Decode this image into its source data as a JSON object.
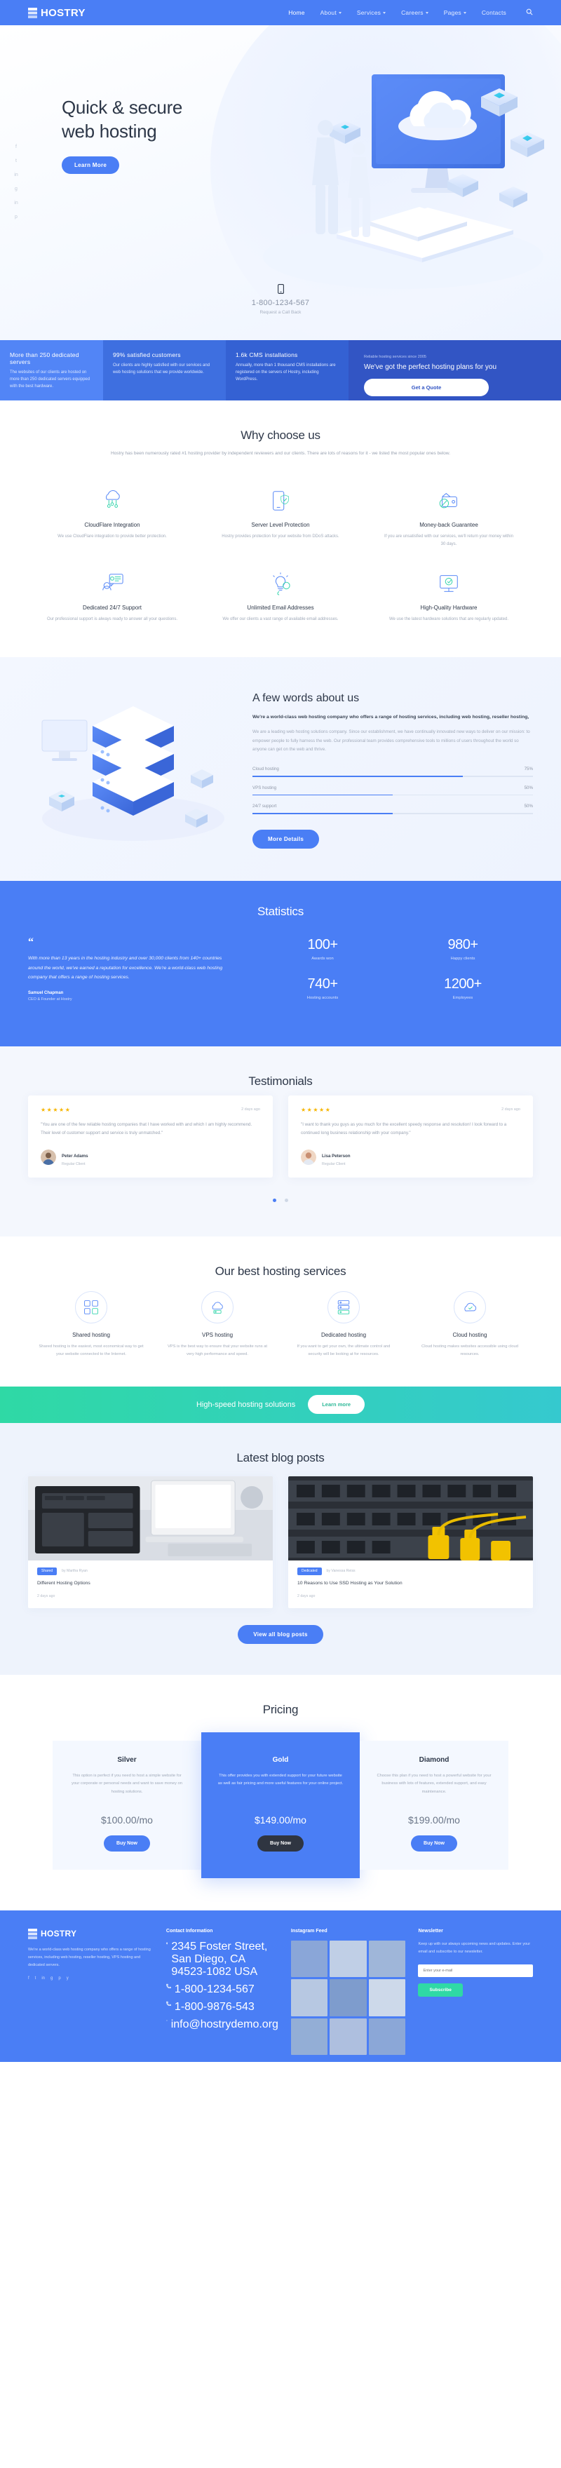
{
  "brand": {
    "name": "HOSTRY",
    "accent": "#4a7ef5",
    "teal": "#2fd9a5",
    "dark": "#2f3541"
  },
  "header": {
    "nav": [
      {
        "label": "Home",
        "caret": false,
        "active": true
      },
      {
        "label": "About",
        "caret": true,
        "active": false
      },
      {
        "label": "Services",
        "caret": true,
        "active": false
      },
      {
        "label": "Careers",
        "caret": true,
        "active": false
      },
      {
        "label": "Pages",
        "caret": true,
        "active": false
      },
      {
        "label": "Contacts",
        "caret": false,
        "active": false
      }
    ],
    "search_icon": "search-icon"
  },
  "hero": {
    "title_line1": "Quick & secure",
    "title_line2": "web hosting",
    "cta": "Learn More",
    "social": [
      "f",
      "t",
      "in",
      "g",
      "in",
      "p"
    ],
    "phone_icon": "mobile-phone-icon",
    "phone": "1-800-1234-567",
    "phone_sub": "Request a Call Back"
  },
  "featurebar": {
    "items": [
      {
        "title": "More than 250 dedicated servers",
        "text": "The websites of our clients are hosted on more than 250 dedicated servers equipped with the best hardware."
      },
      {
        "title": "99% satisfied customers",
        "text": "Our clients are highly satisfied with our services and web hosting solutions that we provide worldwide."
      },
      {
        "title": "1.6k CMS installations",
        "text": "Annually, more than 1 thousand CMS installations are registered on the servers of Hostry, including WordPress."
      }
    ],
    "promo": {
      "eyebrow": "Reliable hosting services since 2005",
      "title": "We've got the perfect hosting plans for you",
      "button": "Get a Quote"
    }
  },
  "why": {
    "title": "Why choose us",
    "subtitle": "Hostry has been numerously rated #1 hosting provider by independent reviewers and our clients. There are lots of reasons for it - we listed the most popular ones below.",
    "items": [
      {
        "icon": "cloudflare-cloud-icon",
        "title": "CloudFlare Integration",
        "text": "We use CloudFlare integration to provide better protection."
      },
      {
        "icon": "shield-phone-icon",
        "title": "Server Level Protection",
        "text": "Hostry provides protection for your website from DDoS attacks."
      },
      {
        "icon": "wallet-icon",
        "title": "Money-back Guarantee",
        "text": "If you are unsatisfied with our services, we'll return your money within 30 days."
      },
      {
        "icon": "headset-support-icon",
        "title": "Dedicated 24/7 Support",
        "text": "Our professional support is always ready to answer all your questions."
      },
      {
        "icon": "lightbulb-icon",
        "title": "Unlimited Email Addresses",
        "text": "We offer our clients a vast range of available email addresses."
      },
      {
        "icon": "monitor-icon",
        "title": "High-Quality Hardware",
        "text": "We use the latest hardware solutions that are regularly updated."
      }
    ]
  },
  "about": {
    "title": "A few words about us",
    "lead": "We're a world-class web hosting company who offers a range of hosting services, including web hosting, reseller hosting,",
    "body": "We are a leading web hosting solutions company. Since our establishment, we have continually innovated new ways to deliver on our mission: to empower people to fully harness the web. Our professional team provides comprehensive tools to millions of users throughout the world so anyone can get on the web and thrive.",
    "bars": [
      {
        "label": "Cloud hosting",
        "value": "75%",
        "pct": 75
      },
      {
        "label": "VPS hosting",
        "value": "50%",
        "pct": 50
      },
      {
        "label": "24/7 support",
        "value": "50%",
        "pct": 50
      }
    ],
    "cta": "More Details"
  },
  "statistics": {
    "title": "Statistics",
    "quote": {
      "mark": "“",
      "text": "With more than 13 years in the hosting industry and over 30,000 clients from 140+ countries around the world, we've earned a reputation for excellence. We're a world-class web hosting company that offers a range of hosting services.",
      "name": "Samuel Chapman",
      "role": "CEO & Founder at Hostry"
    },
    "counters": [
      {
        "num": "100+",
        "label": "Awards won"
      },
      {
        "num": "980+",
        "label": "Happy clients"
      },
      {
        "num": "740+",
        "label": "Hosting accounts"
      },
      {
        "num": "1200+",
        "label": "Employees"
      }
    ]
  },
  "testimonials": {
    "title": "Testimonials",
    "cards": [
      {
        "stars": "★★★★★",
        "date": "2 days ago",
        "text": "\"You are one of the few reliable hosting companies that I have worked with and which I am highly recommend. Their level of customer support and service is truly unmatched.\"",
        "name": "Peter Adams",
        "role": "Regular Client",
        "avatar_tone": "#7b5e49"
      },
      {
        "stars": "★★★★★",
        "date": "2 days ago",
        "text": "\"I want to thank you guys as you much for the excellent speedy response and resolution! I look forward to a continued long business relationship with your company.\"",
        "name": "Lisa Peterson",
        "role": "Regular Client",
        "avatar_tone": "#c98f72"
      }
    ],
    "dots": [
      true,
      false
    ]
  },
  "services": {
    "title": "Our best hosting services",
    "items": [
      {
        "icon": "shared-hosting-icon",
        "title": "Shared hosting",
        "text": "Shared hosting is the easiest, most economical way to get your website connected to the Internet."
      },
      {
        "icon": "vps-cloud-icon",
        "title": "VPS hosting",
        "text": "VPS is the best way to ensure that your website runs at very high performance and speed."
      },
      {
        "icon": "dedicated-server-icon",
        "title": "Dedicated hosting",
        "text": "If you want to get your own, the ultimate control and security will be looking at for resources."
      },
      {
        "icon": "cloud-hosting-icon",
        "title": "Cloud hosting",
        "text": "Cloud hosting makes websites accessible using cloud resources."
      }
    ]
  },
  "cta_strip": {
    "title": "High-speed hosting solutions",
    "button": "Learn more"
  },
  "blog": {
    "title": "Latest blog posts",
    "posts": [
      {
        "tag": "Shared",
        "author": "by Martha Ryan",
        "title": "Different Hosting Options",
        "date": "2 days ago",
        "image": "laptop-hardware-photo"
      },
      {
        "tag": "Dedicated",
        "author": "by Vanessa Reiss",
        "title": "10 Reasons to Use SSD Hosting as Your Solution",
        "date": "2 days ago",
        "image": "network-cables-photo"
      }
    ],
    "button": "View all blog posts"
  },
  "pricing": {
    "title": "Pricing",
    "plans": [
      {
        "name": "Silver",
        "desc": "This option is perfect if you need to host a simple website for your corporate or personal needs and want to save money on hosting solutions.",
        "price": "$100.00/mo",
        "button": "Buy Now",
        "featured": false
      },
      {
        "name": "Gold",
        "desc": "This offer provides you with extended support for your future website as well as fair pricing and more useful features for your online project.",
        "price": "$149.00/mo",
        "button": "Buy Now",
        "featured": true
      },
      {
        "name": "Diamond",
        "desc": "Choose this plan if you need to host a powerful website for your business with lots of features, extended support, and easy maintenance.",
        "price": "$199.00/mo",
        "button": "Buy Now",
        "featured": false
      }
    ]
  },
  "footer": {
    "about": {
      "text": "We're a world-class web hosting company who offers a range of hosting services, including web hosting, reseller hosting, VPS hosting and dedicated servers.",
      "social": [
        "f",
        "t",
        "in",
        "g",
        "p",
        "y"
      ]
    },
    "contact": {
      "title": "Contact Information",
      "address_label": "location-pin-icon",
      "address": "2345 Foster Street, San Diego, CA 94523-1082 USA",
      "phone_label": "phone-icon",
      "phone": "1-800-1234-567",
      "phone2": "1-800-9876-543",
      "email_label": "envelope-icon",
      "email": "info@hostrydemo.org"
    },
    "instagram": {
      "title": "Instagram Feed",
      "cells": [
        "#8aa6d8",
        "#c0cfe6",
        "#9fb6d9",
        "#b7c8e2",
        "#7e9ccd",
        "#cdd9ea",
        "#93aed6",
        "#aebfdf",
        "#8ba7d7"
      ]
    },
    "newsletter": {
      "title": "Newsletter",
      "text": "Keep up with our always upcoming news and updates. Enter your email and subscribe to our newsletter.",
      "placeholder": "Enter your e-mail",
      "value": "",
      "button": "Subscribe"
    }
  }
}
